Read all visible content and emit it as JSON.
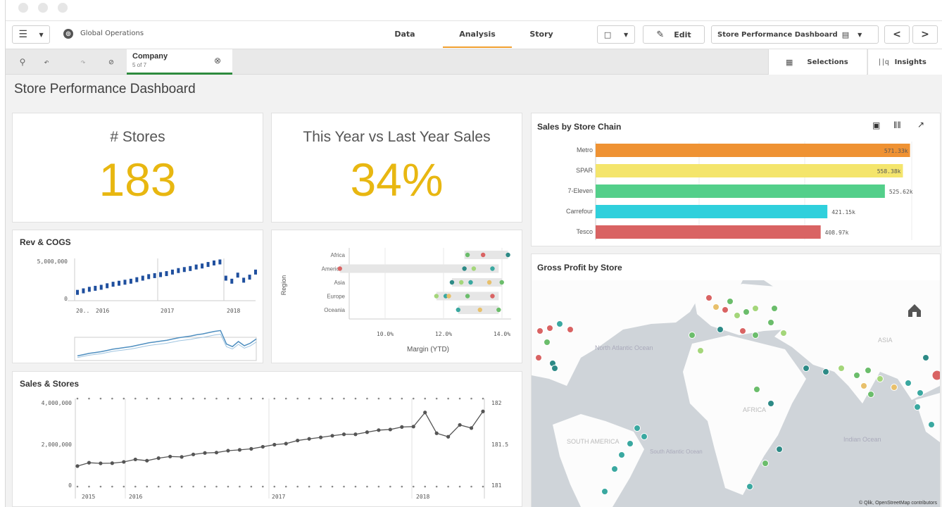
{
  "topbar": {
    "menu_icon": "hamburger-menu-icon",
    "app_icon": "globe-icon",
    "app_name": "Global Operations",
    "tabs": [
      {
        "label": "Data",
        "active": false
      },
      {
        "label": "Analysis",
        "active": true
      },
      {
        "label": "Story",
        "active": false
      }
    ],
    "edit_label": "Edit",
    "sheet_name": "Store Performance Dashboard",
    "prev_label": "<",
    "next_label": ">"
  },
  "selections_bar": {
    "current": {
      "field": "Company",
      "info": "5 of 7"
    },
    "selections_label": "Selections",
    "insights_label": "Insights"
  },
  "sheet_title": "Store Performance Dashboard",
  "kpis": [
    {
      "label": "# Stores",
      "value": "183"
    },
    {
      "label": "This Year vs Last Year Sales",
      "value": "34%"
    }
  ],
  "rev_cogs": {
    "title": "Rev & COGS",
    "y_ticks": [
      "5,000,000",
      "0"
    ],
    "x_ticks": [
      "20..",
      "2016",
      "2017",
      "2018"
    ]
  },
  "margin_chart": {
    "categories": [
      "Africa",
      "Americas",
      "Asia",
      "Europe",
      "Oceania"
    ],
    "ylabel": "Region",
    "xlabel": "Margin (YTD)",
    "x_ticks": [
      "10.0%",
      "12.0%",
      "14.0%"
    ]
  },
  "sales_stores": {
    "title": "Sales & Stores",
    "y_ticks": [
      "4,000,000",
      "2,000,000",
      "0"
    ],
    "y2_ticks": [
      "182",
      "181.5",
      "181"
    ],
    "x_ticks": [
      "2015",
      "2016",
      "2017",
      "2018"
    ]
  },
  "sales_by_chain": {
    "title": "Sales by Store Chain",
    "icons": [
      "camera-icon",
      "columns-icon",
      "expand-icon"
    ]
  },
  "gross_profit": {
    "title": "Gross Profit by Store",
    "map_labels": [
      "North Atlantic Ocean",
      "AFRICA",
      "SOUTH AMERICA",
      "South Atlantic Ocean",
      "Indian Ocean",
      "ASIA"
    ],
    "attribution": "© Qlik, OpenStreetMap contributors"
  },
  "colors": {
    "accent": "#e8b711",
    "active_tab": "#f0a030",
    "selection_green": "#2e8b3e"
  },
  "chart_data": [
    {
      "type": "bar",
      "orientation": "horizontal",
      "title": "Sales by Store Chain",
      "categories": [
        "Metro",
        "SPAR",
        "7-Eleven",
        "Carrefour",
        "Tesco"
      ],
      "values": [
        571330,
        558380,
        525620,
        421150,
        408970
      ],
      "value_labels": [
        "571.33k",
        "558.38k",
        "525.62k",
        "421.15k",
        "408.97k"
      ],
      "colors": [
        "#ef9233",
        "#f4e56c",
        "#53cf8a",
        "#2fd0dc",
        "#d96363"
      ],
      "xlim": [
        0,
        600000
      ]
    },
    {
      "type": "line",
      "title": "Sales & Stores",
      "x": [
        2015.0,
        2015.1,
        2015.2,
        2015.3,
        2015.4,
        2015.5,
        2015.6,
        2015.7,
        2015.8,
        2015.9,
        2016.0,
        2016.1,
        2016.2,
        2016.3,
        2016.4,
        2016.5,
        2016.6,
        2016.7,
        2016.8,
        2016.9,
        2017.0,
        2017.1,
        2017.2,
        2017.3,
        2017.4,
        2017.5,
        2017.6,
        2017.7,
        2017.8,
        2017.9,
        2018.0,
        2018.1,
        2018.2,
        2018.3,
        2018.4,
        2018.5
      ],
      "series": [
        {
          "values": [
            920000,
            1080000,
            1050000,
            1060000,
            1120000,
            1240000,
            1180000,
            1300000,
            1380000,
            1360000,
            1480000,
            1550000,
            1570000,
            1660000,
            1700000,
            1750000,
            1850000,
            1950000,
            2000000,
            2150000,
            2230000,
            2300000,
            2380000,
            2450000,
            2450000,
            2550000,
            2650000,
            2680000,
            2800000,
            2820000,
            3500000,
            2500000,
            2330000,
            2900000,
            2750000,
            3550000
          ]
        }
      ],
      "ylim": [
        0,
        4000000
      ]
    },
    {
      "type": "scatter",
      "title": "Margin (YTD)",
      "categories": [
        "Africa",
        "Americas",
        "Asia",
        "Europe",
        "Oceania"
      ],
      "points": [
        {
          "region": "Africa",
          "x": [
            12.8,
            13.3,
            14.1
          ],
          "range": [
            12.7,
            14.1
          ]
        },
        {
          "region": "Americas",
          "x": [
            8.7,
            12.7,
            13.0,
            13.6
          ],
          "range": [
            8.7,
            13.8
          ]
        },
        {
          "region": "Asia",
          "x": [
            12.3,
            12.6,
            12.9,
            13.5,
            13.9
          ],
          "range": [
            12.3,
            13.9
          ]
        },
        {
          "region": "Europe",
          "x": [
            11.8,
            12.1,
            12.2,
            12.8,
            13.6
          ],
          "range": [
            11.8,
            13.8
          ]
        },
        {
          "region": "Oceania",
          "x": [
            12.5,
            13.2,
            13.8
          ],
          "range": [
            12.5,
            13.8
          ]
        }
      ],
      "xlim": [
        9,
        14.2
      ]
    },
    {
      "type": "line",
      "title": "Rev & COGS",
      "series": [
        {
          "name": "",
          "values": [
            300000,
            450000,
            600000,
            700000,
            800000,
            950000,
            1100000,
            1200000,
            1300000,
            1400000,
            1550000,
            1700000,
            1850000,
            1950000,
            2050000,
            2150000,
            2300000,
            2450000,
            2550000,
            2650000,
            2800000,
            2900000,
            3050000,
            3200000,
            3300000,
            1700000,
            1400000,
            2000000,
            1500000,
            1800000,
            2300000
          ]
        }
      ],
      "ylim": [
        0,
        5000000
      ]
    }
  ]
}
